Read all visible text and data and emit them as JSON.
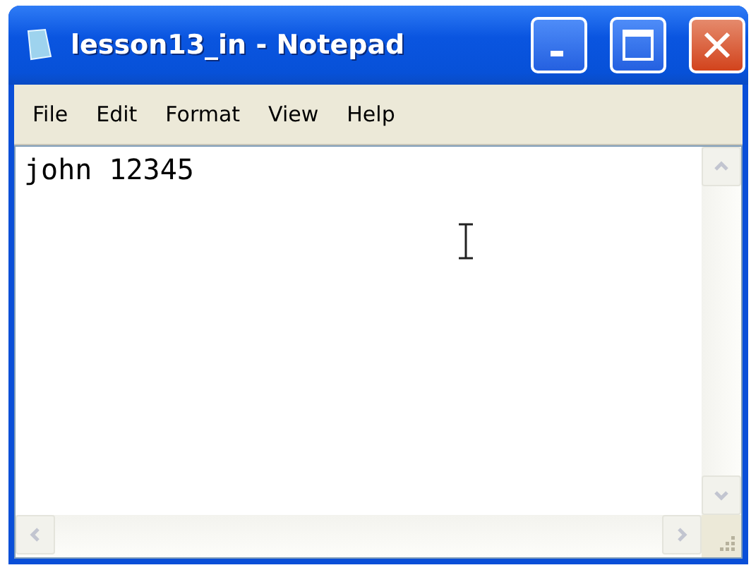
{
  "window": {
    "title": "lesson13_in - Notepad"
  },
  "menu": [
    "File",
    "Edit",
    "Format",
    "View",
    "Help"
  ],
  "editor": {
    "value": "john 12345"
  }
}
